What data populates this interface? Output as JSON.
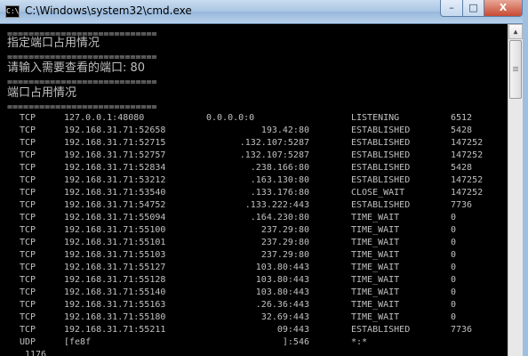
{
  "window": {
    "title": "C:\\Windows\\system32\\cmd.exe",
    "icon_text": "C:\\",
    "minimize": "–",
    "maximize": "□",
    "close": "X"
  },
  "console": {
    "separator": "============================",
    "heading1": "指定端口占用情况",
    "prompt": "请输入需要查看的端口: 80",
    "heading2": "端口占用情况",
    "rows": [
      {
        "proto": "TCP",
        "local": "127.0.0.1:48080",
        "remote": "0.0.0.0:0",
        "state": "LISTENING",
        "pid": "6512"
      },
      {
        "proto": "TCP",
        "local": "192.168.31.71:52658",
        "remote": "193.42:80",
        "state": "ESTABLISHED",
        "pid": "5428"
      },
      {
        "proto": "TCP",
        "local": "192.168.31.71:52715",
        "remote": ".132.107:5287",
        "state": "ESTABLISHED",
        "pid": "147252"
      },
      {
        "proto": "TCP",
        "local": "192.168.31.71:52757",
        "remote": ".132.107:5287",
        "state": "ESTABLISHED",
        "pid": "147252"
      },
      {
        "proto": "TCP",
        "local": "192.168.31.71:52834",
        "remote": ".238.166:80",
        "state": "ESTABLISHED",
        "pid": "5428"
      },
      {
        "proto": "TCP",
        "local": "192.168.31.71:53212",
        "remote": ".163.130:80",
        "state": "ESTABLISHED",
        "pid": "147252"
      },
      {
        "proto": "TCP",
        "local": "192.168.31.71:53540",
        "remote": ".133.176:80",
        "state": "CLOSE_WAIT",
        "pid": "147252"
      },
      {
        "proto": "TCP",
        "local": "192.168.31.71:54752",
        "remote": ".133.222:443",
        "state": "ESTABLISHED",
        "pid": "7736"
      },
      {
        "proto": "TCP",
        "local": "192.168.31.71:55094",
        "remote": ".164.230:80",
        "state": "TIME_WAIT",
        "pid": "0"
      },
      {
        "proto": "TCP",
        "local": "192.168.31.71:55100",
        "remote": "237.29:80",
        "state": "TIME_WAIT",
        "pid": "0"
      },
      {
        "proto": "TCP",
        "local": "192.168.31.71:55101",
        "remote": "237.29:80",
        "state": "TIME_WAIT",
        "pid": "0"
      },
      {
        "proto": "TCP",
        "local": "192.168.31.71:55103",
        "remote": "237.29:80",
        "state": "TIME_WAIT",
        "pid": "0"
      },
      {
        "proto": "TCP",
        "local": "192.168.31.71:55127",
        "remote": "103.80:443",
        "state": "TIME_WAIT",
        "pid": "0"
      },
      {
        "proto": "TCP",
        "local": "192.168.31.71:55128",
        "remote": "103.80:443",
        "state": "TIME_WAIT",
        "pid": "0"
      },
      {
        "proto": "TCP",
        "local": "192.168.31.71:55140",
        "remote": "103.80:443",
        "state": "TIME_WAIT",
        "pid": "0"
      },
      {
        "proto": "TCP",
        "local": "192.168.31.71:55163",
        "remote": ".26.36:443",
        "state": "TIME_WAIT",
        "pid": "0"
      },
      {
        "proto": "TCP",
        "local": "192.168.31.71:55180",
        "remote": "32.69:443",
        "state": "TIME_WAIT",
        "pid": "0"
      },
      {
        "proto": "TCP",
        "local": "192.168.31.71:55211",
        "remote": "09:443",
        "state": "ESTABLISHED",
        "pid": "7736"
      },
      {
        "proto": "UDP",
        "local": "[fe8f",
        "remote": "]:546",
        "state": "*:*",
        "pid": ""
      }
    ],
    "partial_last": "1176"
  },
  "scrollbar": {
    "up_arrow": "▲"
  }
}
